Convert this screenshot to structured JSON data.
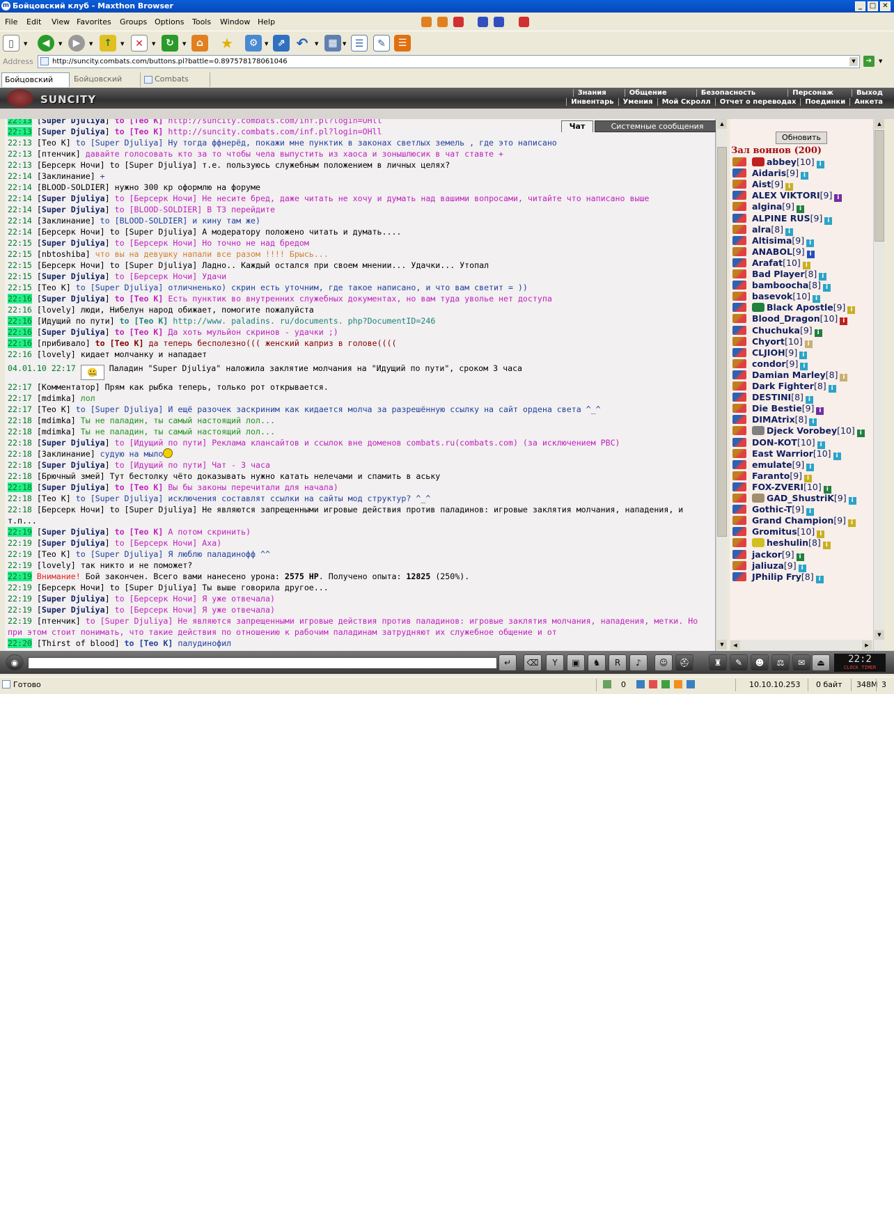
{
  "window": {
    "title": "Бойцовский клуб - Maxthon Browser"
  },
  "menu": [
    "File",
    "Edit",
    "View",
    "Favorites",
    "Groups",
    "Options",
    "Tools",
    "Window",
    "Help"
  ],
  "address": {
    "label": "Address",
    "url": "http://suncity.combats.com/buttons.pl?battle=0.897578178061046"
  },
  "tabs": [
    {
      "label": "Бойцовский клуб",
      "active": true
    },
    {
      "label": "Бойцовский клуб...",
      "active": false
    },
    {
      "label": "Combats Scroll...",
      "active": false
    }
  ],
  "game": {
    "logo": "SUNCITY",
    "nav_top": [
      "Знания",
      "Общение",
      "Безопасность",
      "Персонаж",
      "Выход"
    ],
    "nav_bottom": [
      "Инвентарь",
      "Умения",
      "Мой Скролл",
      "Отчет о переводах",
      "Поединки",
      "Анкета"
    ]
  },
  "chat_tabs": {
    "chat": "Чат",
    "system": "Системные сообщения"
  },
  "chat": [
    {
      "time": "22:13",
      "hl": true,
      "nick": "Super Djuliya",
      "nick_bold": true,
      "to": "to [Teo K]",
      "to_bold": true,
      "msg": "http://suncity.combats.com/inf.pl?login=OHll",
      "mc": "mpurple"
    },
    {
      "time": "22:13",
      "hl": true,
      "nick": "Super Djuliya",
      "nick_bold": true,
      "to": "to [Teo K]",
      "to_bold": true,
      "msg": "http://suncity.combats.com/inf.pl?login=OHll",
      "mc": "mpurple"
    },
    {
      "time": "22:13",
      "hl": false,
      "nick": "Teo K",
      "nick_bold": false,
      "to": "to [Super Djuliya]",
      "to_bold": false,
      "msg": "Ну тогда ффнерёд, покажи мне пунктик в законах светлых земель , где это написано",
      "mc": "mblue"
    },
    {
      "time": "22:13",
      "hl": false,
      "nick": "птенчик",
      "nick_bold": false,
      "to": "",
      "to_bold": false,
      "msg": "давайте голосовать кто за то чтобы чела выпустить из хаоса и зонышлюсик в чат ставте +",
      "mc": "mpurple"
    },
    {
      "time": "22:13",
      "hl": false,
      "nick": "Берсерк Ночи",
      "nick_bold": false,
      "to": "to [Super Djuliya]",
      "to_bold": false,
      "msg": "т.е. пользуюсь служебным положением в личных целях?",
      "mc": "mblack"
    },
    {
      "time": "22:14",
      "hl": false,
      "nick": "Заклинание",
      "nick_bold": false,
      "to": "",
      "to_bold": false,
      "msg": "+",
      "mc": "mblue"
    },
    {
      "time": "22:14",
      "hl": false,
      "nick": "BLOOD-SOLDIER",
      "nick_bold": false,
      "to": "",
      "to_bold": false,
      "msg": "нужно 300 кр оформлю на форуме",
      "mc": "mblack"
    },
    {
      "time": "22:14",
      "hl": false,
      "nick": "Super Djuliya",
      "nick_bold": true,
      "to": "to [Берсерк Ночи]",
      "to_bold": false,
      "msg": "Не несите бред, даже читать не хочу и думать над вашими вопросами, читайте что написано выше",
      "mc": "mpurple"
    },
    {
      "time": "22:14",
      "hl": false,
      "nick": "Super Djuliya",
      "nick_bold": true,
      "to": "to [BLOOD-SOLDIER]",
      "to_bold": false,
      "msg": "В Т3 перейдите",
      "mc": "mpurple"
    },
    {
      "time": "22:14",
      "hl": false,
      "nick": "Заклинание",
      "nick_bold": false,
      "to": "to [BLOOD-SOLDIER]",
      "to_bold": false,
      "msg": "и кину там же)",
      "mc": "mblue"
    },
    {
      "time": "22:14",
      "hl": false,
      "nick": "Берсерк Ночи",
      "nick_bold": false,
      "to": "to [Super Djuliya]",
      "to_bold": false,
      "msg": "А модератору положено читать и думать....",
      "mc": "mblack"
    },
    {
      "time": "22:15",
      "hl": false,
      "nick": "Super Djuliya",
      "nick_bold": true,
      "to": "to [Берсерк Ночи]",
      "to_bold": false,
      "msg": "Но точно не над бредом",
      "mc": "mpurple"
    },
    {
      "time": "22:15",
      "hl": false,
      "nick": "nbtoshiba",
      "nick_bold": false,
      "to": "",
      "to_bold": false,
      "msg": "что вы на девушку напали все разом !!!! Брысь...",
      "mc": "morange"
    },
    {
      "time": "22:15",
      "hl": false,
      "nick": "Берсерк Ночи",
      "nick_bold": false,
      "to": "to [Super Djuliya]",
      "to_bold": false,
      "msg": "Ладно.. Каждый остался при своем мнении... Удачки... Утопал",
      "mc": "mblack"
    },
    {
      "time": "22:15",
      "hl": false,
      "nick": "Super Djuliya",
      "nick_bold": true,
      "to": "to [Берсерк Ночи]",
      "to_bold": false,
      "msg": "Удачи",
      "mc": "mpurple"
    },
    {
      "time": "22:15",
      "hl": false,
      "nick": "Teo K",
      "nick_bold": false,
      "to": "to [Super Djuliya]",
      "to_bold": false,
      "msg": "отличненько) скрин есть уточним, где такое написано, и что вам светит = ))",
      "mc": "mblue"
    },
    {
      "time": "22:16",
      "hl": true,
      "nick": "Super Djuliya",
      "nick_bold": true,
      "to": "to [Teo K]",
      "to_bold": true,
      "msg": "Есть пунктик во внутренних служебных документах, но вам туда уволье нет доступа",
      "mc": "mpurple"
    },
    {
      "time": "22:16",
      "hl": false,
      "nick": "lovely",
      "nick_bold": false,
      "to": "",
      "to_bold": false,
      "msg": "люди, Нибелун народ обижает, помогите пожалуйста",
      "mc": "mblack"
    },
    {
      "time": "22:16",
      "hl": true,
      "nick": "Идущий по пути",
      "nick_bold": false,
      "to": "to [Teo K]",
      "to_bold": true,
      "msg": "http://www. paladins. ru/documents. php?DocumentID=246",
      "mc": "mteal"
    },
    {
      "time": "22:16",
      "hl": true,
      "nick": "Super Djuliya",
      "nick_bold": true,
      "to": "to [Teo K]",
      "to_bold": true,
      "msg": "Да хоть мульйон скринов - удачки ;)",
      "mc": "mpurple"
    },
    {
      "time": "22:16",
      "hl": true,
      "nick": "прибивало",
      "nick_bold": false,
      "to": "to [Teo K]",
      "to_bold": true,
      "msg": "да теперь бесполезно((( женский каприз в голове((((",
      "mc": "mdark"
    },
    {
      "time": "22:16",
      "hl": false,
      "nick": "lovely",
      "nick_bold": false,
      "to": "",
      "to_bold": false,
      "msg": "кидает молчанку и нападает",
      "mc": "mblack"
    }
  ],
  "system_line": {
    "datetime": "04.01.10 22:17",
    "text": "Паладин \"Super Djuliya\" наложила заклятие молчания на \"Идущий по пути\", сроком 3 часа"
  },
  "chat2": [
    {
      "time": "22:17",
      "hl": false,
      "nick": "Комментатор",
      "nick_bold": false,
      "to": "",
      "to_bold": false,
      "msg": "Прям как рыбка теперь, только рот открывается.",
      "mc": "mblack"
    },
    {
      "time": "22:17",
      "hl": false,
      "nick": "mdimka",
      "nick_bold": false,
      "to": "",
      "to_bold": false,
      "msg": "лол",
      "mc": "mgreen"
    },
    {
      "time": "22:17",
      "hl": false,
      "nick": "Teo K",
      "nick_bold": false,
      "to": "to [Super Djuliya]",
      "to_bold": false,
      "msg": "И ещё разочек заскриним как кидается молча за разрешённую ссылку на сайт ордена света ^_^",
      "mc": "mblue"
    },
    {
      "time": "22:18",
      "hl": false,
      "nick": "mdimka",
      "nick_bold": false,
      "to": "",
      "to_bold": false,
      "msg": "Ты не паладин, ты самый настоящий лол...",
      "mc": "mgreen"
    },
    {
      "time": "22:18",
      "hl": false,
      "nick": "mdimka",
      "nick_bold": false,
      "to": "",
      "to_bold": false,
      "msg": "Ты не паладин, ты самый настоящий лол...",
      "mc": "mgreen"
    },
    {
      "time": "22:18",
      "hl": false,
      "nick": "Super Djuliya",
      "nick_bold": true,
      "to": "to [Идущий по пути]",
      "to_bold": false,
      "msg": "Реклама клансайтов и ссылок вне доменов combats.ru(combats.com) (за исключением РВС)",
      "mc": "mpurple"
    },
    {
      "time": "22:18",
      "hl": false,
      "nick": "Заклинание",
      "nick_bold": false,
      "to": "",
      "to_bold": false,
      "msg": "судую на мыло",
      "mc": "mblue",
      "smiley": true
    },
    {
      "time": "22:18",
      "hl": false,
      "nick": "Super Djuliya",
      "nick_bold": true,
      "to": "to [Идущий по пути]",
      "to_bold": false,
      "msg": "Чат - 3 часа",
      "mc": "mpurple"
    },
    {
      "time": "22:18",
      "hl": false,
      "nick": "Брючный змей",
      "nick_bold": false,
      "to": "",
      "to_bold": false,
      "msg": "Тут бестолку чёто доказывать нужно катать нелечами и спамить в аську",
      "mc": "mblack"
    },
    {
      "time": "22:18",
      "hl": true,
      "nick": "Super Djuliya",
      "nick_bold": true,
      "to": "to [Teo K]",
      "to_bold": true,
      "msg": "Вы бы законы перечитали для начала)",
      "mc": "mpurple"
    },
    {
      "time": "22:18",
      "hl": false,
      "nick": "Teo K",
      "nick_bold": false,
      "to": "to [Super Djuliya]",
      "to_bold": false,
      "msg": "исключения составлят ссылки на сайты мод структур? ^_^",
      "mc": "mblue"
    },
    {
      "time": "22:18",
      "hl": false,
      "nick": "Берсерк Ночи",
      "nick_bold": false,
      "to": "to [Super Djuliya]",
      "to_bold": false,
      "msg": "Не являются запрещенными игровые действия против паладинов: игровые заклятия молчания, нападения, и т.п...",
      "mc": "mblack",
      "wrap": true
    },
    {
      "time": "22:19",
      "hl": true,
      "nick": "Super Djuliya",
      "nick_bold": true,
      "to": "to [Teo K]",
      "to_bold": true,
      "msg": "А потом скринить)",
      "mc": "mpurple"
    },
    {
      "time": "22:19",
      "hl": false,
      "nick": "Super Djuliya",
      "nick_bold": true,
      "to": "to [Берсерк Ночи]",
      "to_bold": false,
      "msg": "Аха)",
      "mc": "mpurple"
    },
    {
      "time": "22:19",
      "hl": false,
      "nick": "Teo K",
      "nick_bold": false,
      "to": "to [Super Djuliya]",
      "to_bold": false,
      "msg": "Я люблю паладинофф ^^",
      "mc": "mblue"
    },
    {
      "time": "22:19",
      "hl": false,
      "nick": "lovely",
      "nick_bold": false,
      "to": "",
      "to_bold": false,
      "msg": "так никто и не поможет?",
      "mc": "mblack"
    }
  ],
  "battle_end": {
    "time": "22:19",
    "warning": "Внимание!",
    "text1": "Бой закончен. Всего вами нанесено урона:",
    "dmg": "2575 HP",
    "text2": ". Получено опыта:",
    "exp": "12825",
    "text3": "(250%)."
  },
  "chat3": [
    {
      "time": "22:19",
      "hl": false,
      "nick": "Берсерк Ночи",
      "nick_bold": false,
      "to": "to [Super Djuliya]",
      "to_bold": false,
      "msg": "Ты выше говорила другое...",
      "mc": "mblack"
    },
    {
      "time": "22:19",
      "hl": false,
      "nick": "Super Djuliya",
      "nick_bold": true,
      "to": "to [Берсерк Ночи]",
      "to_bold": false,
      "msg": "Я уже отвечала)",
      "mc": "mpurple"
    },
    {
      "time": "22:19",
      "hl": false,
      "nick": "Super Djuliya",
      "nick_bold": true,
      "to": "to [Берсерк Ночи]",
      "to_bold": false,
      "msg": "Я уже отвечала)",
      "mc": "mpurple"
    },
    {
      "time": "22:19",
      "hl": false,
      "nick": "птенчик",
      "nick_bold": false,
      "to": "to [Super Djuliya]",
      "to_bold": false,
      "msg": "Не являются запрещенными игровые действия против паладинов: игровые заклятия молчания, нападения, метки. Но при этом стоит понимать, что такие действия по отношению к рабочим паладинам затрудняют их служебное общение и от",
      "mc": "mpurple",
      "wrap": true
    },
    {
      "time": "22:20",
      "hl": true,
      "nick": "Thirst of blood",
      "nick_bold": false,
      "to": "to [Teo K]",
      "to_bold": true,
      "msg": "палудинофил",
      "mc": "mblue"
    }
  ],
  "panel": {
    "refresh": "Обновить",
    "hall": "Зал воинов (200)",
    "warriors": [
      {
        "name": "abbey",
        "lvl": "[10]",
        "clan": "#c02020",
        "info": "#2aa4c8"
      },
      {
        "name": "Aidaris",
        "lvl": "[9]",
        "clan": "",
        "info": "#2aa4c8"
      },
      {
        "name": "Aist",
        "lvl": "[9]",
        "clan": "",
        "info": "#c8b020"
      },
      {
        "name": "ALEX VIKTORI",
        "lvl": "[9]",
        "clan": "",
        "info": "#7030a0"
      },
      {
        "name": "algina",
        "lvl": "[9]",
        "clan": "",
        "info": "#208040"
      },
      {
        "name": "ALPINE RUS",
        "lvl": "[9]",
        "clan": "",
        "info": "#2aa4c8"
      },
      {
        "name": "alra",
        "lvl": "[8]",
        "clan": "",
        "info": "#2aa4c8"
      },
      {
        "name": "Altisima",
        "lvl": "[9]",
        "clan": "",
        "info": "#2aa4c8"
      },
      {
        "name": "ANABOL",
        "lvl": "[9]",
        "clan": "",
        "info": "#2050c0"
      },
      {
        "name": "Arafat",
        "lvl": "[10]",
        "clan": "",
        "info": "#c8b020"
      },
      {
        "name": "Bad Player",
        "lvl": "[8]",
        "clan": "",
        "info": "#2aa4c8"
      },
      {
        "name": "bamboocha",
        "lvl": "[8]",
        "clan": "",
        "info": "#2aa4c8"
      },
      {
        "name": "basevok",
        "lvl": "[10]",
        "clan": "",
        "info": "#2aa4c8"
      },
      {
        "name": "Black Apostle",
        "lvl": "[9]",
        "clan": "#208040",
        "info": "#c8b020"
      },
      {
        "name": "Blood_Dragon",
        "lvl": "[10]",
        "clan": "",
        "info": "#c02020"
      },
      {
        "name": "Chuchuka",
        "lvl": "[9]",
        "clan": "",
        "info": "#208040"
      },
      {
        "name": "Chyort",
        "lvl": "[10]",
        "clan": "",
        "info": "#c8b070"
      },
      {
        "name": "CLJIOH",
        "lvl": "[9]",
        "clan": "",
        "info": "#2aa4c8"
      },
      {
        "name": "condor",
        "lvl": "[9]",
        "clan": "",
        "info": "#2aa4c8"
      },
      {
        "name": "Damian Marley",
        "lvl": "[8]",
        "clan": "",
        "info": "#c8b070"
      },
      {
        "name": "Dark Fighter",
        "lvl": "[8]",
        "clan": "",
        "info": "#2aa4c8"
      },
      {
        "name": "DESTINI",
        "lvl": "[8]",
        "clan": "",
        "info": "#2aa4c8"
      },
      {
        "name": "Die Bestie",
        "lvl": "[9]",
        "clan": "",
        "info": "#7030a0"
      },
      {
        "name": "DIMAtrix",
        "lvl": "[8]",
        "clan": "",
        "info": "#2aa4c8"
      },
      {
        "name": "Djeck Vorobey",
        "lvl": "[10]",
        "clan": "#808080",
        "info": "#208040"
      },
      {
        "name": "DON-KOT",
        "lvl": "[10]",
        "clan": "",
        "info": "#2aa4c8"
      },
      {
        "name": "East Warrior",
        "lvl": "[10]",
        "clan": "",
        "info": "#2aa4c8"
      },
      {
        "name": "emulate",
        "lvl": "[9]",
        "clan": "",
        "info": "#2aa4c8"
      },
      {
        "name": "Faranto",
        "lvl": "[9]",
        "clan": "",
        "info": "#c8b020"
      },
      {
        "name": "FOX-ZVERI",
        "lvl": "[10]",
        "clan": "",
        "info": "#208040"
      },
      {
        "name": "GAD_ShustriK",
        "lvl": "[9]",
        "clan": "#a09070",
        "info": "#2aa4c8"
      },
      {
        "name": "Gothic-T",
        "lvl": "[9]",
        "clan": "",
        "info": "#2aa4c8"
      },
      {
        "name": "Grand Champion",
        "lvl": "[9]",
        "clan": "",
        "info": "#c8b020"
      },
      {
        "name": "Gromitus",
        "lvl": "[10]",
        "clan": "",
        "info": "#c8b020"
      },
      {
        "name": "heshulin",
        "lvl": "[8]",
        "clan": "#d0c020",
        "info": "#c8b020"
      },
      {
        "name": "jackor",
        "lvl": "[9]",
        "clan": "",
        "info": "#208040"
      },
      {
        "name": "jaliuza",
        "lvl": "[9]",
        "clan": "",
        "info": "#2aa4c8"
      },
      {
        "name": "JPhilip Fry",
        "lvl": "[8]",
        "clan": "",
        "info": "#2aa4c8"
      }
    ]
  },
  "clock": {
    "time": "22:2",
    "label": "CLOCK TIMER"
  },
  "status": {
    "ready": "Готово",
    "count": "0",
    "ip": "10.10.10.253",
    "bytes": "0 байт",
    "mem": "348M",
    "num": "3"
  }
}
